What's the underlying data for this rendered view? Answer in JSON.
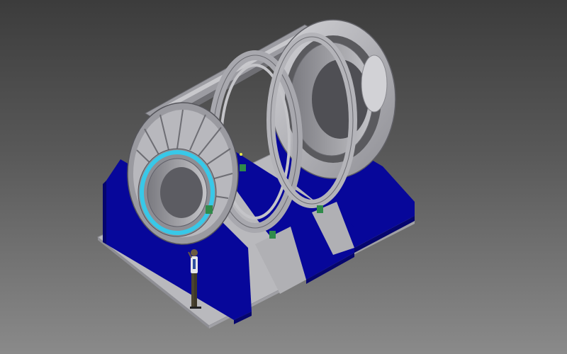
{
  "scene": {
    "subject": "cad-render-turbine-assembly",
    "colors": {
      "background_top": "#3c3c3c",
      "background_bottom": "#8a8a8a",
      "platform": "#b9b9bd",
      "platform_edge": "#8f8f95",
      "support_blue": "#07079a",
      "support_blue_dark": "#05056e",
      "metal_light": "#c9c9cc",
      "metal_mid": "#a4a4a8",
      "metal_dark": "#6f6f74",
      "accent_cyan": "#38c8e8",
      "accent_green": "#2f8a4a",
      "figure_shirt": "#e6e6ea",
      "figure_pants": "#4a4330"
    }
  }
}
